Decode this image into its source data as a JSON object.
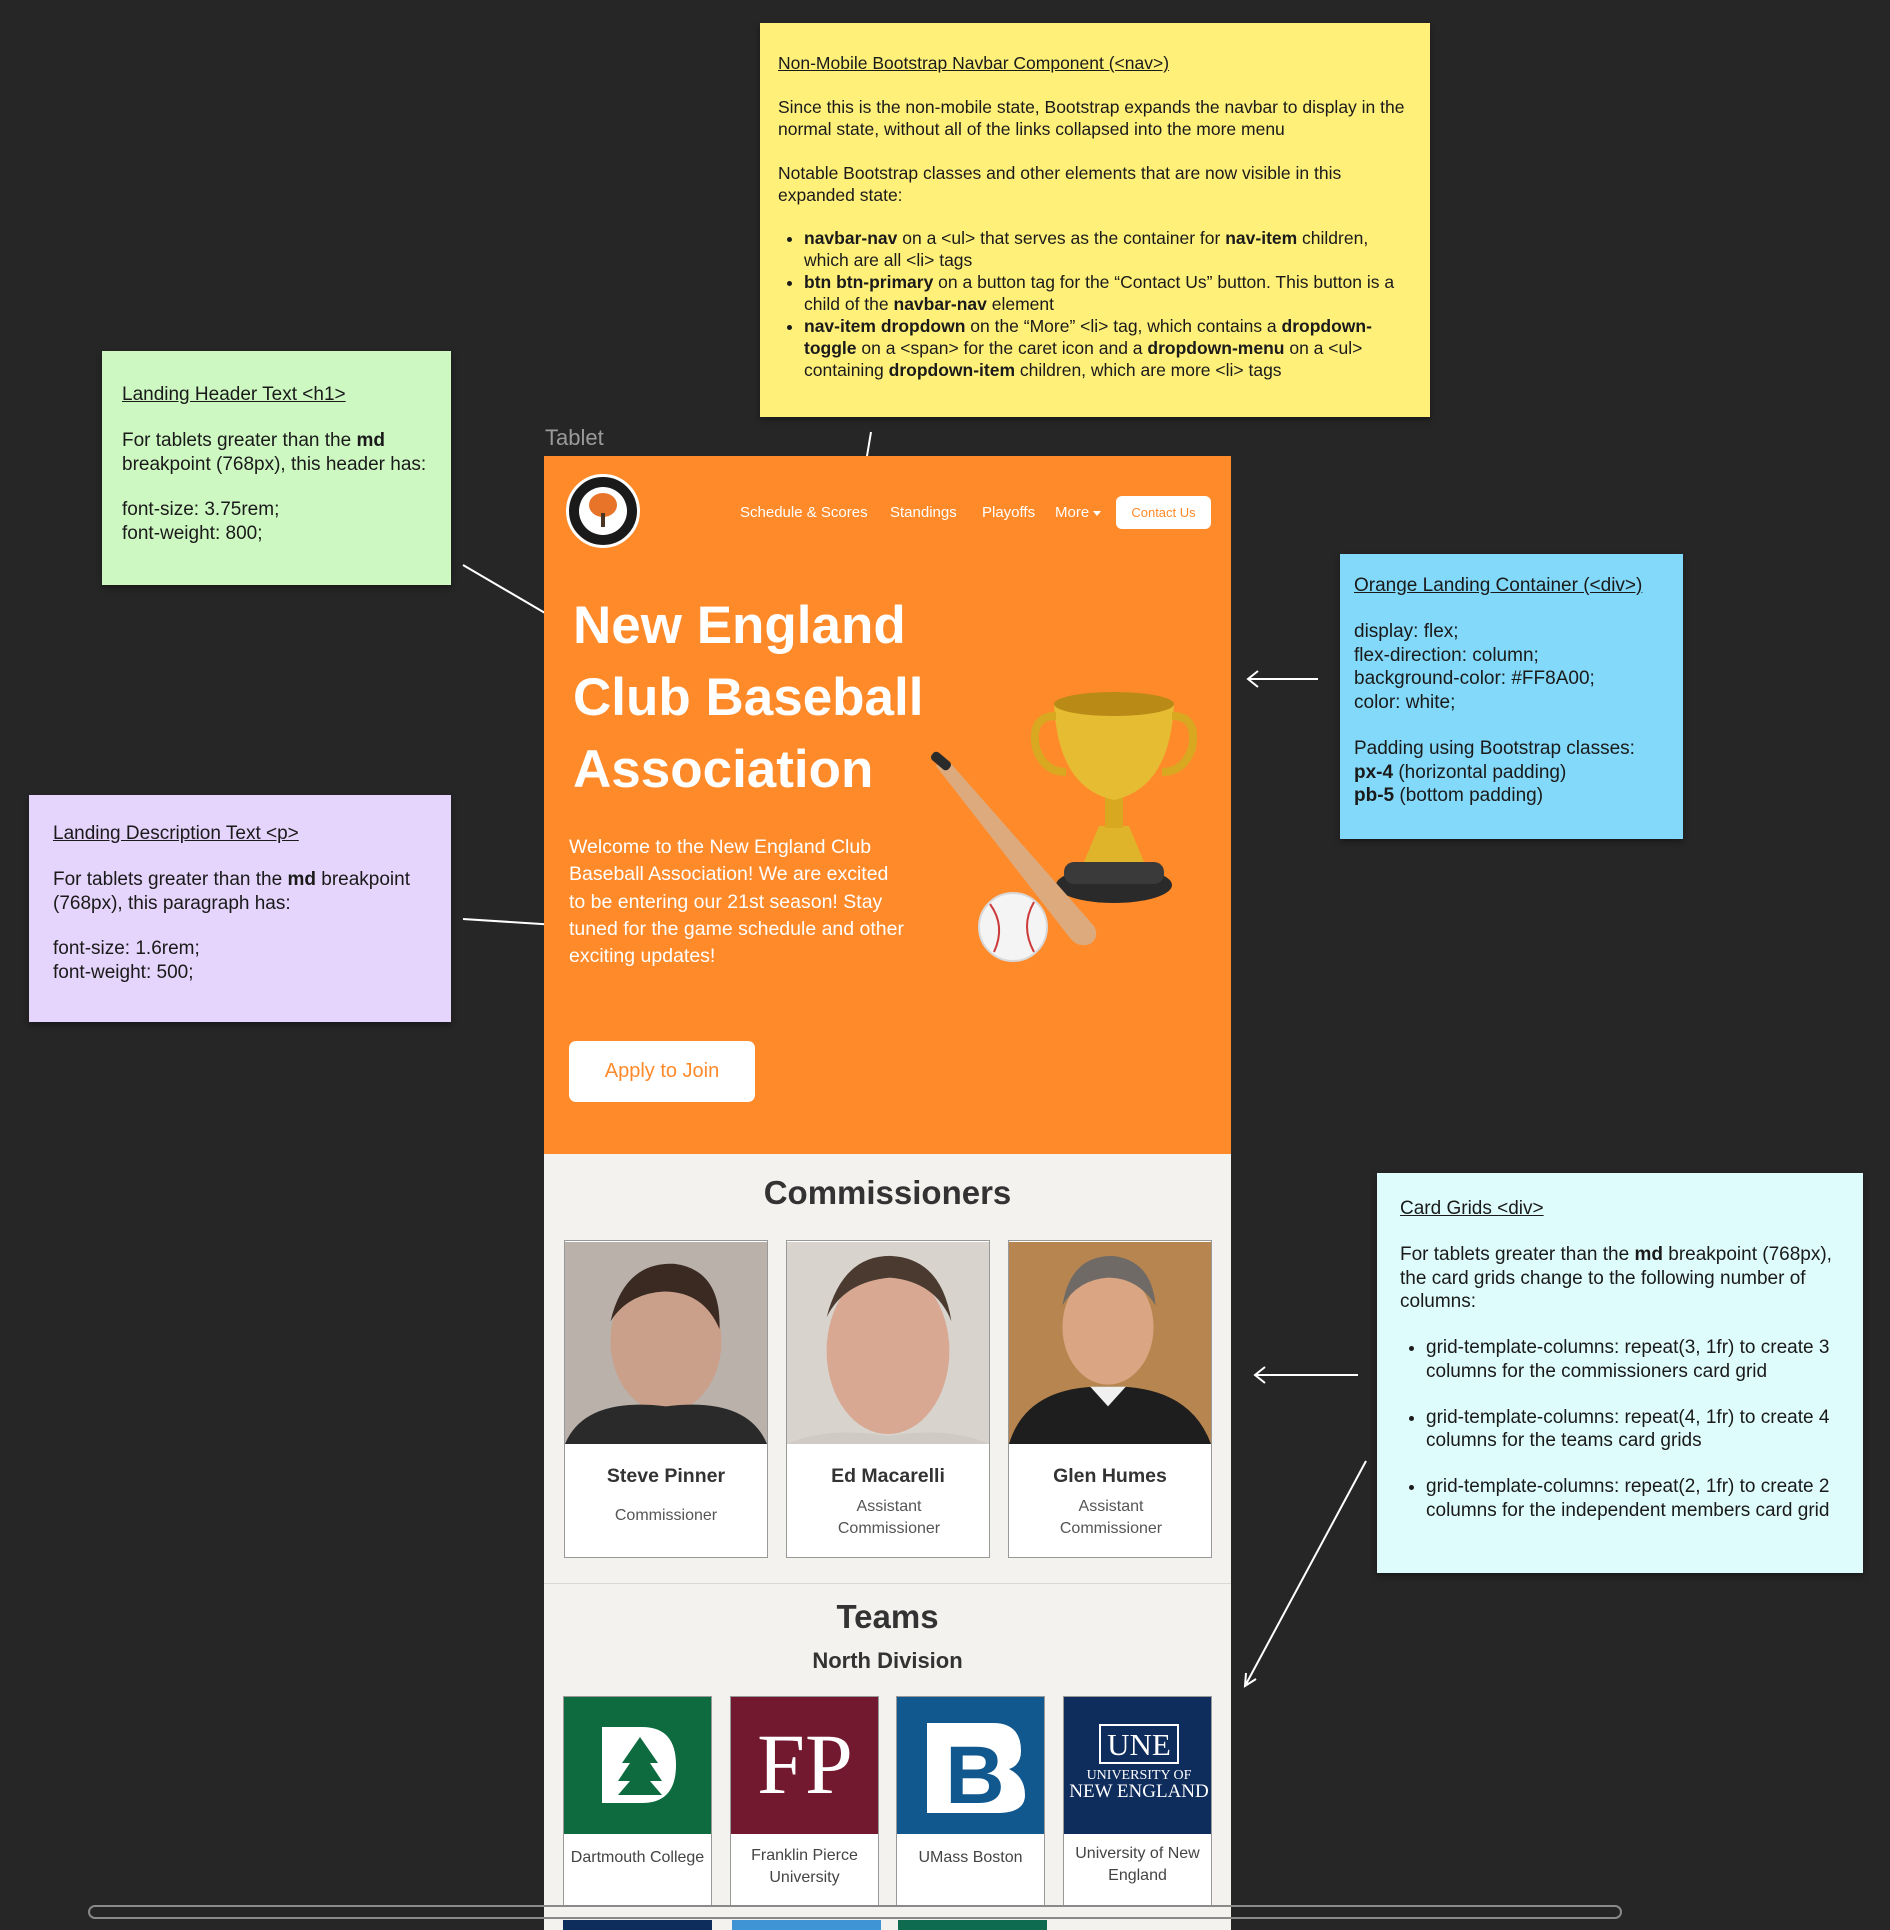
{
  "notes": {
    "nav": {
      "title": "Non-Mobile Bootstrap Navbar Component (<nav>)",
      "p1": "Since this is the non-mobile state, Bootstrap expands the navbar to display in the normal state, without all of the links collapsed into the more menu",
      "p2": "Notable Bootstrap classes and other elements that are now visible in this expanded state:",
      "b1_bold": "navbar-nav",
      "b1_a": " on a <ul> that serves as the container for ",
      "b1_bold2": "nav-item",
      "b1_b": " children, which are all <li> tags",
      "b2_bold": "btn btn-primary",
      "b2_a": " on a button tag for the “Contact Us” button. This button is a child of the ",
      "b2_bold2": "navbar-nav",
      "b2_b": " element",
      "b3_bold": "nav-item dropdown",
      "b3_a": " on the “More” <li> tag, which contains a ",
      "b3_bold2": "dropdown-toggle",
      "b3_b": " on a <span> for the caret icon and a ",
      "b3_bold3": "dropdown-menu",
      "b3_c": " on a <ul> containing ",
      "b3_bold4": "dropdown-item",
      "b3_d": " children, which are more <li> tags"
    },
    "h1": {
      "title": "Landing Header Text <h1>",
      "line_a": "For tablets greater than the ",
      "bold": "md",
      "line_b": " breakpoint (768px), this header has:",
      "v1": "font-size: 3.75rem;",
      "v2": "font-weight: 800;"
    },
    "p": {
      "title": "Landing Description Text <p>",
      "line_a": "For tablets greater than the ",
      "bold": "md",
      "line_b": " breakpoint (768px), this paragraph has:",
      "v1": "font-size: 1.6rem;",
      "v2": "font-weight: 500;"
    },
    "landing": {
      "title": "Orange Landing Container (<div>)",
      "v1": "display: flex;",
      "v2": "flex-direction: column;",
      "v3": "background-color: #FF8A00;",
      "v4": "color: white;",
      "v5": "Padding using Bootstrap classes:",
      "v6_bold": "px-4",
      "v6": " (horizontal padding)",
      "v7_bold": "pb-5",
      "v7": " (bottom padding)"
    },
    "cards": {
      "title": "Card Grids <div>",
      "line_a": "For tablets greater than the ",
      "bold": "md",
      "line_b": " breakpoint (768px), the card grids change to the following number of columns:",
      "b1": "grid-template-columns: repeat(3, 1fr) to create 3 columns for the commissioners card grid",
      "b2": "grid-template-columns: repeat(4, 1fr) to create 4 columns for the teams card grids",
      "b3": "grid-template-columns: repeat(2, 1fr) to create 2 columns for the independent members card grid"
    }
  },
  "frame_label": "Tablet",
  "nav": {
    "links": [
      "Schedule & Scores",
      "Standings",
      "Playoffs",
      "More"
    ],
    "contact": "Contact Us"
  },
  "landing": {
    "title_lines": [
      "New England",
      "Club Baseball",
      "Association"
    ],
    "description": "Welcome to the New England Club Baseball Association! We are excited to be entering our 21st season! Stay tuned for the game schedule and other exciting updates!",
    "apply": "Apply to Join"
  },
  "commissioners": {
    "title": "Commissioners",
    "people": [
      {
        "name": "Steve Pinner",
        "role": "Commissioner"
      },
      {
        "name": "Ed Macarelli",
        "role": "Assistant Commissioner"
      },
      {
        "name": "Glen Humes",
        "role": "Assistant Commissioner"
      }
    ]
  },
  "teams": {
    "title": "Teams",
    "division": "North Division",
    "items": [
      {
        "name": "Dartmouth College",
        "logo": "D",
        "color": "#0e6b3f"
      },
      {
        "name": "Franklin Pierce University",
        "logo": "FP",
        "color": "#73192f"
      },
      {
        "name": "UMass Boston",
        "logo": "B",
        "color": "#11588f"
      },
      {
        "name": "University of New England",
        "logo": "UNE",
        "logo_sub": "UNIVERSITY OF",
        "logo_sub2": "NEW ENGLAND",
        "color": "#0f2d5c"
      }
    ]
  },
  "colors": {
    "landing_bg": "#FF8A2A",
    "accent": "#FF8A2A"
  }
}
